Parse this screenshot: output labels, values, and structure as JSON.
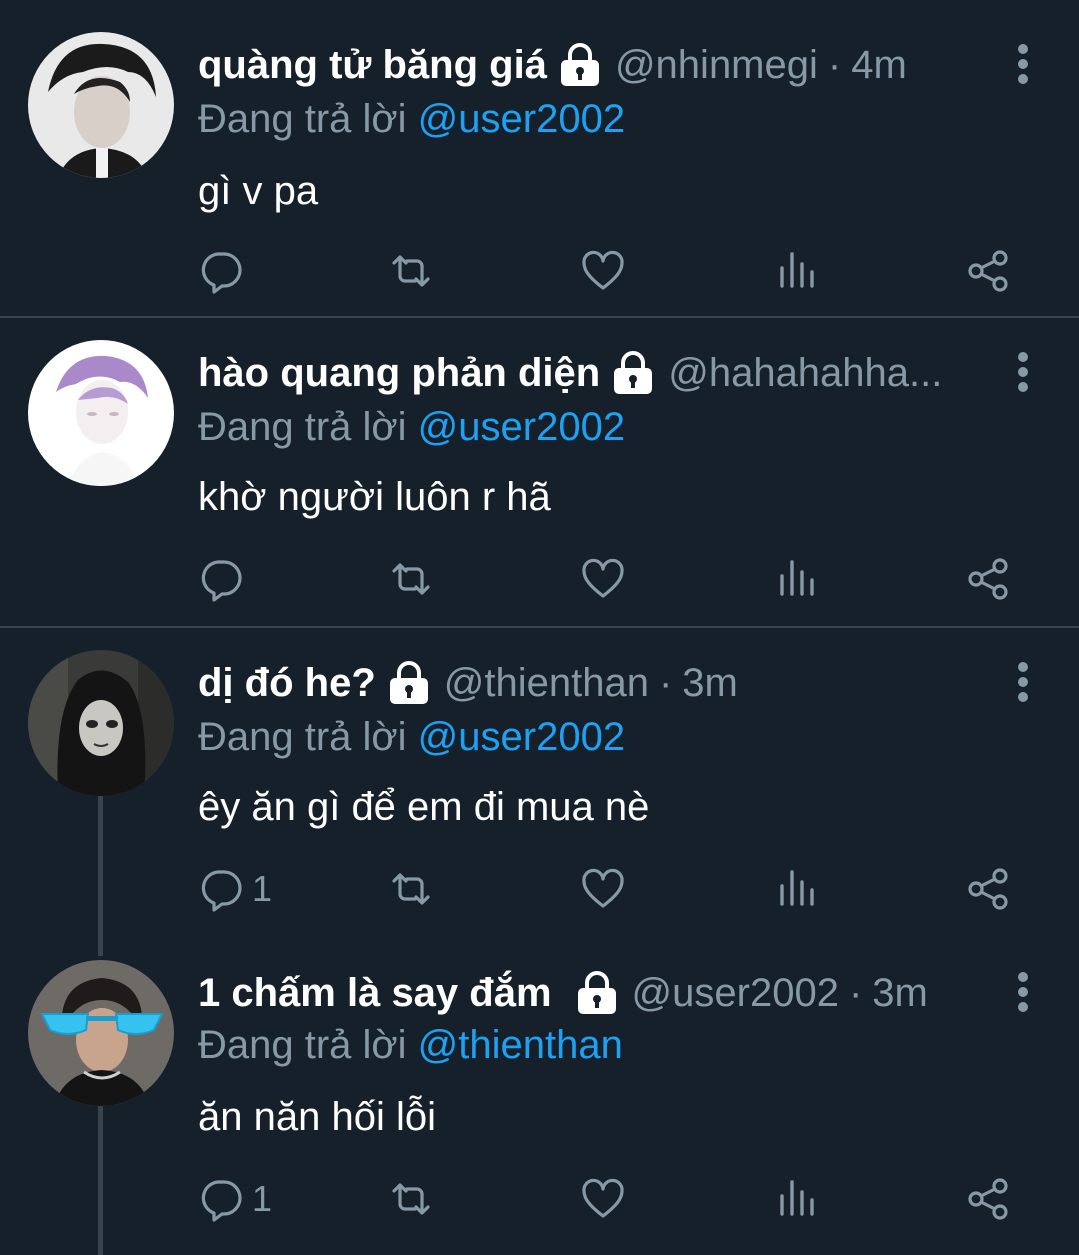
{
  "tweets": [
    {
      "name": "quàng tử băng giá",
      "handle": "@nhinmegi",
      "dot": "·",
      "time": "4m",
      "reply_prefix": "Đang trả lời",
      "reply_to": "@user2002",
      "text": "gì v pa",
      "reply_count": ""
    },
    {
      "name": "hào quang phản diện",
      "handle": "@hahahahha...",
      "dot": "",
      "time": "",
      "reply_prefix": "Đang trả lời",
      "reply_to": "@user2002",
      "text": "khờ người luôn r hã",
      "reply_count": ""
    },
    {
      "name": "dị đó he?",
      "handle": "@thienthan",
      "dot": "·",
      "time": "3m",
      "reply_prefix": "Đang trả lời",
      "reply_to": "@user2002",
      "text": "êy ăn gì để em đi mua nè",
      "reply_count": "1"
    },
    {
      "name": "1 chấm là say đắm",
      "handle": "@user2002",
      "dot": "·",
      "time": "3m",
      "reply_prefix": "Đang trả lời",
      "reply_to": "@thienthan",
      "text": "ăn năn hối lỗi",
      "reply_count": "1"
    }
  ],
  "icons": {
    "reply": "reply-icon",
    "retweet": "retweet-icon",
    "like": "heart-icon",
    "analytics": "analytics-icon",
    "share": "share-icon",
    "more": "more-vertical-icon",
    "lock": "lock-icon"
  },
  "colors": {
    "background": "#15202b",
    "secondary_text": "#8899a6",
    "mention": "#1da1f2",
    "divider": "#38444d"
  }
}
